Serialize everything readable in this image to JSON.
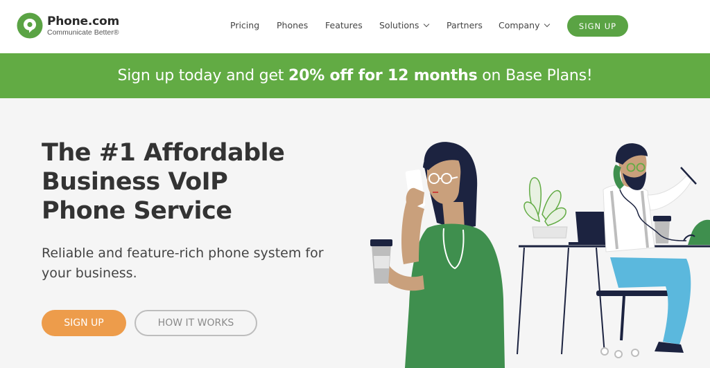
{
  "brand": {
    "name": "Phone.com",
    "tagline": "Communicate Better®",
    "color": "#5aa344"
  },
  "nav": {
    "items": [
      {
        "label": "Pricing",
        "dropdown": false
      },
      {
        "label": "Phones",
        "dropdown": false
      },
      {
        "label": "Features",
        "dropdown": false
      },
      {
        "label": "Solutions",
        "dropdown": true
      },
      {
        "label": "Partners",
        "dropdown": false
      },
      {
        "label": "Company",
        "dropdown": true
      }
    ],
    "signup_label": "SIGN UP"
  },
  "promo": {
    "prefix": "Sign up today and get ",
    "highlight": "20% off for 12 months",
    "suffix": " on Base Plans!",
    "color": "#62ab44"
  },
  "hero": {
    "title": "The #1 Affordable Business VoIP Phone Service",
    "subtitle": "Reliable and feature-rich phone system for your business.",
    "primary_button": "SIGN UP",
    "secondary_button": "HOW IT WORKS",
    "primary_color": "#ed9c4b"
  }
}
